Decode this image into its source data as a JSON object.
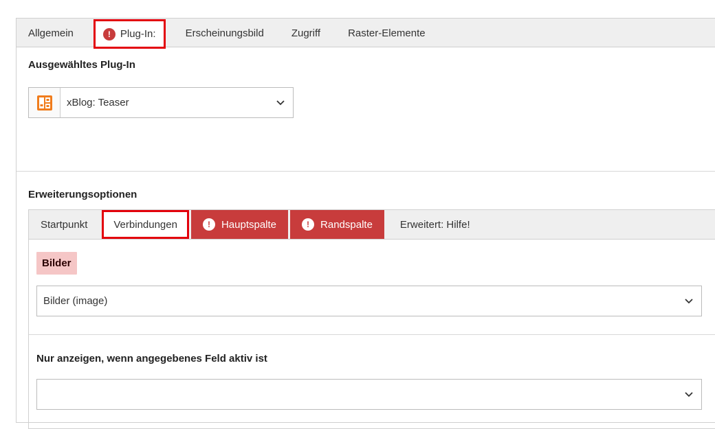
{
  "main_tabs": [
    {
      "label": "Allgemein",
      "state": "normal"
    },
    {
      "label": "Plug-In:",
      "state": "error-active",
      "icon": "exclamation-circle-icon"
    },
    {
      "label": "Erscheinungsbild",
      "state": "normal"
    },
    {
      "label": "Zugriff",
      "state": "normal"
    },
    {
      "label": "Raster-Elemente",
      "state": "normal"
    }
  ],
  "plugin": {
    "heading": "Ausgewähltes Plug-In",
    "selected": "xBlog: Teaser",
    "icon": "plugin-teaser-icon"
  },
  "extension": {
    "heading": "Erweiterungsoptionen",
    "tabs": [
      {
        "label": "Startpunkt",
        "state": "normal"
      },
      {
        "label": "Verbindungen",
        "state": "active"
      },
      {
        "label": "Hauptspalte",
        "state": "error",
        "icon": "exclamation-circle-icon"
      },
      {
        "label": "Randspalte",
        "state": "error",
        "icon": "exclamation-circle-icon"
      },
      {
        "label": "Erweitert: Hilfe!",
        "state": "normal"
      }
    ],
    "bilder_label": "Bilder",
    "bilder_value": "Bilder (image)",
    "condition_label": "Nur anzeigen, wenn angegebenes Feld aktiv ist",
    "condition_value": ""
  },
  "colors": {
    "error": "#c83c3c",
    "highlight_border": "#e3000b",
    "badge_bg": "#f5c6c6",
    "plugin_icon": "#f07c1c"
  }
}
